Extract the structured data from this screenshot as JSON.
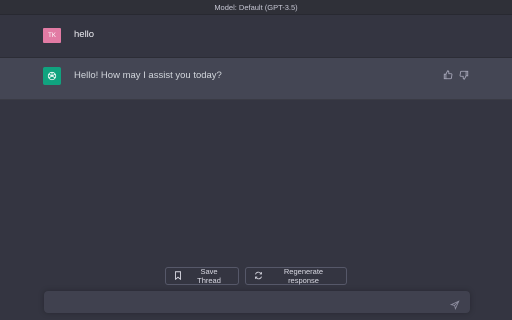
{
  "header": {
    "model_label": "Model: Default (GPT-3.5)"
  },
  "conversation": [
    {
      "role": "user",
      "avatar_initials": "TK",
      "text": "hello",
      "avatar_color": "#e27ba4"
    },
    {
      "role": "assistant",
      "text": "Hello! How may I assist you today?",
      "avatar_color": "#10a37f",
      "avatar_icon": "openai-logo-icon"
    }
  ],
  "feedback": {
    "thumbs_up_icon": "thumbs-up-icon",
    "thumbs_down_icon": "thumbs-down-icon"
  },
  "actions": {
    "save_thread_label": "Save Thread",
    "save_thread_icon": "bookmark-icon",
    "regenerate_label": "Regenerate response",
    "regenerate_icon": "refresh-icon"
  },
  "composer": {
    "placeholder": "",
    "value": "",
    "send_icon": "send-icon"
  },
  "colors": {
    "background": "#343541",
    "assistant_row": "#444654",
    "input_bg": "#40414f"
  }
}
